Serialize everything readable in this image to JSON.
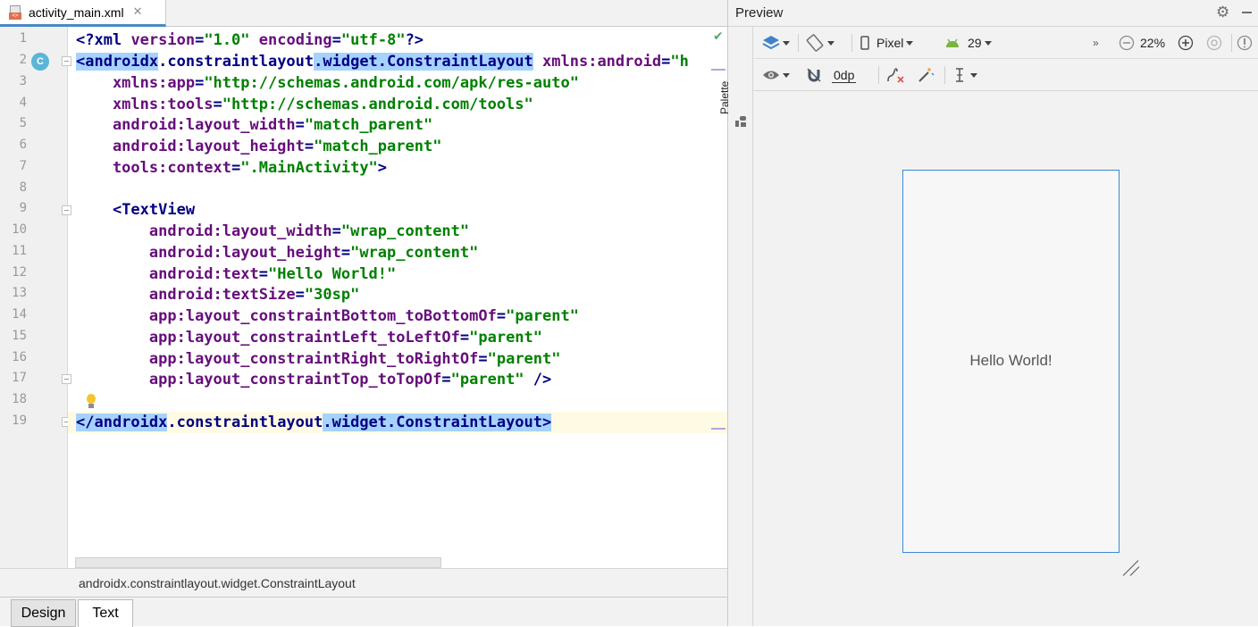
{
  "editor": {
    "tab": {
      "filename": "activity_main.xml",
      "close": "✕"
    },
    "gutter_marker": "C",
    "line_numbers": [
      "1",
      "2",
      "3",
      "4",
      "5",
      "6",
      "7",
      "8",
      "9",
      "10",
      "11",
      "12",
      "13",
      "14",
      "15",
      "16",
      "17",
      "18",
      "19"
    ],
    "code": {
      "l1": {
        "a": "<?",
        "b": "xml ",
        "c": "version",
        "d": "=",
        "e": "\"1.0\"",
        "f": " encoding",
        "g": "=",
        "h": "\"utf-8\"",
        "i": "?>"
      },
      "l2": {
        "a": "<androidx",
        "b": ".",
        "c": "constraintlayout",
        "d": ".widget.ConstraintLayout",
        "e": " ",
        "f": "xmlns:android",
        "g": "=",
        "h": "\"h"
      },
      "l3": {
        "a": "    xmlns:app",
        "b": "=",
        "c": "\"http://schemas.android.com/apk/res-auto\""
      },
      "l4": {
        "a": "    xmlns:tools",
        "b": "=",
        "c": "\"http://schemas.android.com/tools\""
      },
      "l5": {
        "a": "    android",
        "b": ":layout_width",
        "c": "=",
        "d": "\"match_parent\""
      },
      "l6": {
        "a": "    android",
        "b": ":layout_height",
        "c": "=",
        "d": "\"match_parent\""
      },
      "l7": {
        "a": "    tools",
        "b": ":context",
        "c": "=",
        "d": "\".MainActivity\"",
        "e": ">"
      },
      "l8": "",
      "l9": {
        "a": "    <",
        "b": "TextView"
      },
      "l10": {
        "a": "        android",
        "b": ":layout_width",
        "c": "=",
        "d": "\"wrap_content\""
      },
      "l11": {
        "a": "        android",
        "b": ":layout_height",
        "c": "=",
        "d": "\"wrap_content\""
      },
      "l12": {
        "a": "        android",
        "b": ":text",
        "c": "=",
        "d": "\"Hello World!\""
      },
      "l13": {
        "a": "        android",
        "b": ":textSize",
        "c": "=",
        "d": "\"30sp\""
      },
      "l14": {
        "a": "        app",
        "b": ":layout_constraintBottom_toBottomOf",
        "c": "=",
        "d": "\"parent\""
      },
      "l15": {
        "a": "        app",
        "b": ":layout_constraintLeft_toLeftOf",
        "c": "=",
        "d": "\"parent\""
      },
      "l16": {
        "a": "        app",
        "b": ":layout_constraintRight_toRightOf",
        "c": "=",
        "d": "\"parent\""
      },
      "l17": {
        "a": "        app",
        "b": ":layout_constraintTop_toTopOf",
        "c": "=",
        "d": "\"parent\"",
        "e": " />"
      },
      "l18": "",
      "l19": {
        "a": "</androidx",
        "b": ".",
        "c": "constraintlayout",
        "d": ".widget.ConstraintLayout",
        "e": ">"
      }
    },
    "breadcrumb": "androidx.constraintlayout.widget.ConstraintLayout",
    "bottom_tabs": {
      "design": "Design",
      "text": "Text"
    }
  },
  "preview": {
    "title": "Preview",
    "palette_label": "Palette",
    "toolbar1": {
      "device": "Pixel",
      "api_level": "29",
      "overflow": "»",
      "zoom": "22%"
    },
    "toolbar2": {
      "margin": "0dp"
    },
    "phone": {
      "text": "Hello World!"
    }
  },
  "colors": {
    "selection": "#a6d2ff",
    "accent": "#3c89d8",
    "string": "#008000",
    "attribute": "#660e7a",
    "tag": "#000080"
  }
}
